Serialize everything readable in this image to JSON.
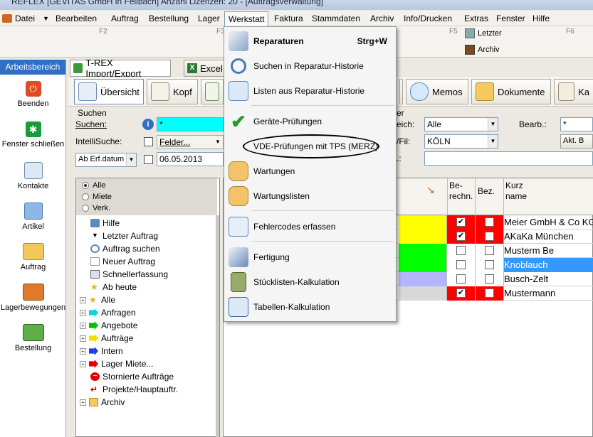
{
  "window": {
    "title": "REFLEX [GEVITAS GmbH in Fellbach] Anzahl Lizenzen: 20 - [Auftragsverwaltung]"
  },
  "menubar": {
    "items": [
      "Datei",
      "Bearbeiten",
      "Auftrag",
      "Bestellung",
      "Lager",
      "Werkstatt",
      "Faktura",
      "Stammdaten",
      "Archiv",
      "Info/Drucken",
      "Extras",
      "Fenster",
      "Hilfe"
    ]
  },
  "fkeys": {
    "f2": "F2",
    "f3": "F3",
    "f5": "F5",
    "f6": "F6"
  },
  "quick": {
    "letzter": "Letzter",
    "archiv": "Archiv"
  },
  "sidebar": {
    "header": "Arbeitsbereich",
    "items": [
      "Beenden",
      "Fenster schließen",
      "Kontakte",
      "Artikel",
      "Auftrag",
      "Lagerbewegungen",
      "Bestellung"
    ]
  },
  "tabs": {
    "trex": "T-REX Import/Export",
    "excel": "Excel"
  },
  "toolbar": {
    "uebersicht": "Übersicht",
    "kopf": "Kopf",
    "memos": "Memos",
    "dokumente": "Dokumente",
    "ka": "Ka"
  },
  "search": {
    "group": "Suchen",
    "suchen_label": "Suchen:",
    "suchen_value": "*",
    "intelli_label": "IntelliSuche:",
    "felder": "Felder...",
    "sort": "Ab Erf.datum",
    "date": "06.05.2013",
    "right_group": "er",
    "reich_label": "eich:",
    "reich_value": "Alle",
    "fil_label": "/Fil:",
    "fil_value": "KÖLN",
    "bearb_label": "Bearb.:",
    "bearb_value": "*",
    "akt_label": "Akt. B"
  },
  "filter": {
    "options": [
      "Alle",
      "Miete",
      "Verk."
    ],
    "selected": "Alle"
  },
  "tree": {
    "items": [
      "Hilfe",
      "Letzter Auftrag",
      "Auftrag suchen",
      "Neuer Auftrag",
      "Schnellerfassung",
      "Ab heute",
      "Alle",
      "Anfragen",
      "Angebote",
      "Aufträge",
      "Intern",
      "Lager Miete...",
      "Stornierte Aufträge",
      "Projekte/Hauptauftr.",
      "Archiv"
    ]
  },
  "grid": {
    "headers": {
      "berechn1": "Be-",
      "berechn2": "rechn.",
      "bez": "Bez.",
      "kurz1": "Kurz",
      "kurz2": "name"
    },
    "rows": [
      {
        "name": "Meier GmbH & Co KG",
        "color": "#ffff00",
        "berechn": true,
        "berechn_bg": "#ff0000",
        "bez": false,
        "bez_bg": "#ff0000"
      },
      {
        "name": "AKaKa München",
        "color": "#ffff00",
        "berechn": true,
        "berechn_bg": "#ff0000",
        "bez": false,
        "bez_bg": "#ff0000"
      },
      {
        "name": "Musterm Be",
        "color": "#00ff00",
        "berechn": false,
        "berechn_bg": "#ffffff",
        "bez": false,
        "bez_bg": "#ffffff"
      },
      {
        "name": "Knoblauch",
        "color": "#00ff00",
        "berechn": false,
        "berechn_bg": "#ffffff",
        "bez": false,
        "bez_bg": "#ffffff",
        "selected": true
      },
      {
        "name": "Busch-Zelt",
        "color": "#b4b4ff",
        "berechn": false,
        "berechn_bg": "#ffffff",
        "bez": false,
        "bez_bg": "#ffffff"
      },
      {
        "name": "Mustermann",
        "color": "#d8d8d8",
        "berechn": true,
        "berechn_bg": "#ff0000",
        "bez": false,
        "bez_bg": "#ff0000"
      }
    ]
  },
  "werkstatt_menu": {
    "items": [
      {
        "label": "Reparaturen",
        "shortcut": "Strg+W",
        "bold": true,
        "icon": "wrench-icon"
      },
      {
        "label": "Suchen in Reparatur-Historie",
        "icon": "magnifier-icon"
      },
      {
        "label": "Listen aus Reparatur-Historie",
        "icon": "list-icon"
      },
      {
        "label": "Geräte-Prüfungen",
        "icon": "checkmark-icon"
      },
      {
        "label": "VDE-Prüfungen mit TPS (MERZ)",
        "icon": ""
      },
      {
        "label": "Wartungen",
        "icon": "hand-icon"
      },
      {
        "label": "Wartungslisten",
        "icon": "hand-list-icon"
      },
      {
        "label": "Fehlercodes erfassen",
        "icon": "pencil-icon"
      },
      {
        "label": "Fertigung",
        "icon": "wrench-icon"
      },
      {
        "label": "Stücklisten-Kalkulation",
        "icon": "calculator-icon"
      },
      {
        "label": "Tabellen-Kalkulation",
        "icon": "spreadsheet-icon"
      }
    ]
  },
  "colors": {
    "accent": "#2f6fc6",
    "selection": "#3399ff",
    "search_field": "#00ffff"
  }
}
